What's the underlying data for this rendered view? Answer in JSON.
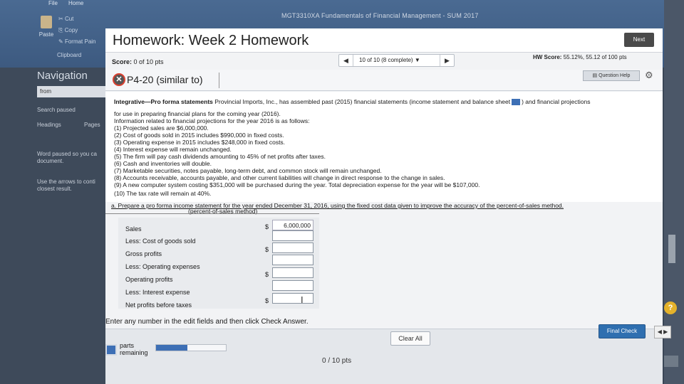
{
  "ribbon": {
    "tabs": [
      "File",
      "Home"
    ],
    "paste_label": "Paste",
    "cut_label": "Cut",
    "copy_label": "Copy",
    "format_painter_label": "Format Pain",
    "clipboard_label": "Clipboard"
  },
  "window": {
    "title": "MGT3310XA Fundamentals of Financial Management - SUM 2017"
  },
  "navigation": {
    "title": "Navigation",
    "search_value": "from",
    "status": "Search paused",
    "tabs": [
      "Headings",
      "Pages"
    ],
    "notes": [
      "Word paused so you ca",
      "document.",
      "Use the arrows to conti",
      "closest result."
    ]
  },
  "homework": {
    "title": "Homework: Week 2 Homework",
    "next_label": "Next",
    "score": "Score: 0 of 10 pts",
    "score_label": "Score:",
    "score_value": "0 of 10 pts",
    "pager_label": "10 of 10 (8 complete)",
    "hw_score_label": "HW Score:",
    "hw_score_value": "55.12%, 55.12 of 100 pts"
  },
  "problem": {
    "id": "P4-20 (similar to)",
    "question_help_label": "Question Help",
    "intro_bold": "Integrative—Pro forma statements",
    "intro_rest": "Provincial Imports, Inc., has assembled past (2015) financial statements (income statement and balance sheet",
    "intro_after_icon": ") and financial projections",
    "lines": [
      "for use in preparing financial plans for the coming year (2016).",
      "Information related to financial projections for the year 2016 is as follows:",
      "(1) Projected sales are $6,000,000.",
      "(2) Cost of goods sold in 2015 includes $990,000 in fixed costs.",
      "(3) Operating expense in 2015 includes $248,000 in fixed costs.",
      "(4) Interest expense will remain unchanged.",
      "(5) The firm will pay cash dividends amounting to 45% of net profits after taxes.",
      "(6) Cash and inventories will double.",
      "(7) Marketable securities, notes payable, long-term debt, and common stock will remain unchanged.",
      "(8) Accounts receivable, accounts payable, and other current liabilities will change in direct response to the change in sales.",
      "(9) A new computer system costing $351,000 will be purchased during the year. Total depreciation expense for the year will be $107,000.",
      "(10) The tax rate will remain at 40%."
    ],
    "part_a": "a. Prepare a pro forma income statement for the year ended December 31, 2016, using the fixed cost data given to improve the accuracy of the percent-of-sales method.",
    "part_a_sub": "(percent-of-sales method)"
  },
  "statement": {
    "rows": [
      {
        "label": "Sales",
        "dollar": "$",
        "value": "6,000,000"
      },
      {
        "label": "Less: Cost of goods sold",
        "dollar": "",
        "value": ""
      },
      {
        "label": "Gross profits",
        "dollar": "$",
        "value": ""
      },
      {
        "label": "Less: Operating expenses",
        "dollar": "",
        "value": ""
      },
      {
        "label": "Operating profits",
        "dollar": "$",
        "value": ""
      },
      {
        "label": "Less: Interest expense",
        "dollar": "",
        "value": ""
      },
      {
        "label": "Net profits before taxes",
        "dollar": "$",
        "value": ""
      }
    ]
  },
  "footer": {
    "instruction": "Enter any number in the edit fields and then click Check Answer.",
    "clear_all_label": "Clear All",
    "final_check_label": "Final Check",
    "parts_label": "parts",
    "remaining_label": "remaining",
    "progress_fraction": 0.45,
    "points": "0 / 10 pts"
  },
  "help_icon": "?"
}
